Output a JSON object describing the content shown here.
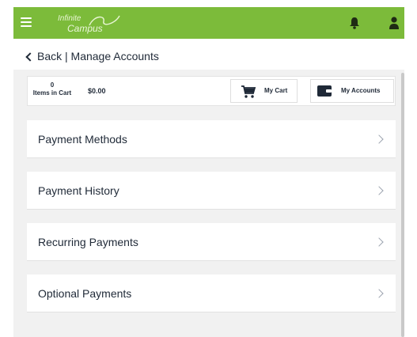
{
  "brand": {
    "line1": "Infinite",
    "line2": "Campus",
    "bar_color": "#7cbb3a"
  },
  "header": {
    "menu_icon": "hamburger-menu-icon",
    "bell_icon": "bell-icon",
    "user_icon": "user-icon"
  },
  "nav": {
    "back_label": "Back | Manage Accounts"
  },
  "cart": {
    "count": "0",
    "count_label": "Items in Cart",
    "total": "$0.00",
    "my_cart_label": "My Cart",
    "my_accounts_label": "My Accounts"
  },
  "options": [
    {
      "label": "Payment Methods"
    },
    {
      "label": "Payment History"
    },
    {
      "label": "Recurring Payments"
    },
    {
      "label": "Optional Payments"
    }
  ]
}
